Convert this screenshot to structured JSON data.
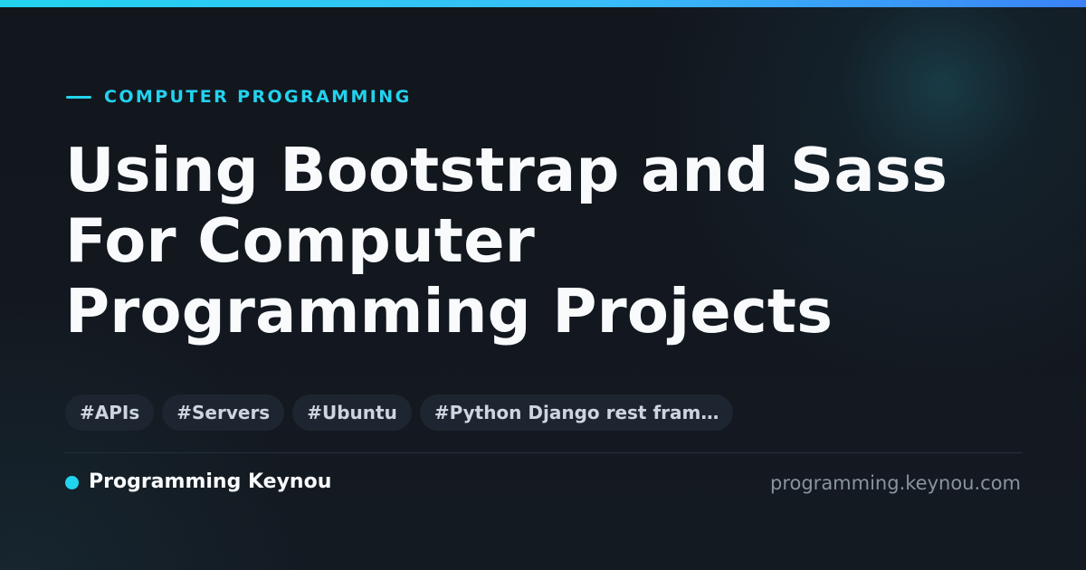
{
  "theme": {
    "accent": "#22d3ee",
    "gradient_end": "#3b82f6",
    "background": "#131820",
    "heading_color": "#f8fafc",
    "tag_background": "#1d2630",
    "muted_text": "#8a939e"
  },
  "category": {
    "label": "COMPUTER PROGRAMMING"
  },
  "headline": {
    "line1": "Using Bootstrap and Sass",
    "line2": "For Computer",
    "line3": "Programming Projects"
  },
  "tags": [
    {
      "label": "#APIs"
    },
    {
      "label": "#Servers"
    },
    {
      "label": "#Ubuntu"
    },
    {
      "label": "#Python Django rest fram…"
    }
  ],
  "footer": {
    "brand_name": "Programming Keynou",
    "domain": "programming.keynou.com"
  }
}
